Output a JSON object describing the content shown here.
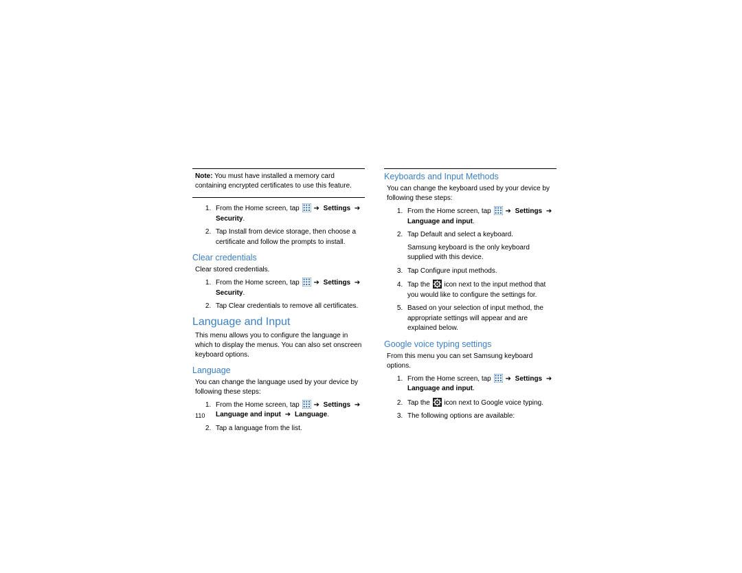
{
  "page_number": "110",
  "left_column": {
    "note_prefix": "Note:",
    "note_text": " You must have installed a memory card containing encrypted certificates to use this feature.",
    "install_steps": {
      "s1_a": "From the Home screen, tap ",
      "s1_b": " Settings ",
      "s1_c": " Security",
      "s2": "Tap Install from device storage, then choose a certificate and follow the prompts to install."
    },
    "clear_heading": "Clear credentials",
    "clear_intro": "Clear stored credentials.",
    "clear_steps": {
      "s1_a": "From the Home screen, tap ",
      "s1_b": " Settings ",
      "s1_c": " Security",
      "s2": "Tap Clear credentials to remove all certificates."
    },
    "lang_input_heading": "Language and Input",
    "lang_input_intro": "This menu allows you to configure the language in which to display the menus. You can also set onscreen keyboard options.",
    "lang_heading": "Language",
    "lang_intro": "You can change the language used by your device by following these steps:",
    "lang_steps": {
      "s1_a": "From the Home screen, tap ",
      "s1_b": " Settings ",
      "s1_c": " Language and input ",
      "s1_d": " Language",
      "s2": "Tap a language from the list."
    }
  },
  "right_column": {
    "kb_heading": "Keyboards and Input Methods",
    "kb_intro": "You can change the keyboard used by your device by following these steps:",
    "kb_steps": {
      "s1_a": "From the Home screen, tap ",
      "s1_b": " Settings ",
      "s1_c": " Language and input",
      "s2": "Tap Default and select a keyboard.",
      "s2b": "Samsung keyboard is the only keyboard supplied with this device.",
      "s3": "Tap Configure input methods.",
      "s4_a": "Tap the ",
      "s4_b": " icon next to the input method that you would like to configure the settings for.",
      "s5": "Based on your selection of input method, the appropriate settings will appear and are explained below."
    },
    "gv_heading": "Google voice typing settings",
    "gv_intro": "From this menu you can set Samsung keyboard options.",
    "gv_steps": {
      "s1_a": "From the Home screen, tap ",
      "s1_b": " Settings ",
      "s1_c": " Language and input",
      "s2_a": "Tap the ",
      "s2_b": " icon next to Google voice typing.",
      "s3": "The following options are available:"
    }
  },
  "glyphs": {
    "arrow": "➔",
    "period": "."
  }
}
